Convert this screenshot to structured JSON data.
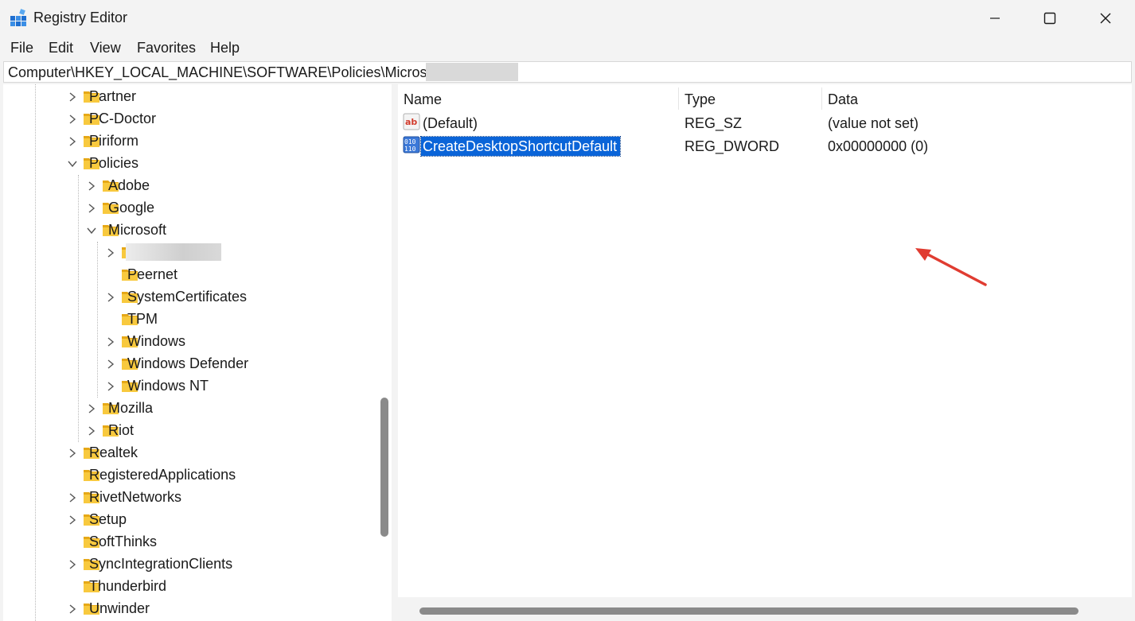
{
  "window": {
    "title": "Registry Editor",
    "controls": {
      "minimize": "minimize",
      "maximize": "maximize",
      "close": "close"
    }
  },
  "menu": [
    "File",
    "Edit",
    "View",
    "Favorites",
    "Help"
  ],
  "address": {
    "path": "Computer\\HKEY_LOCAL_MACHINE\\SOFTWARE\\Policies\\Microsoft\\"
  },
  "tree": {
    "items": [
      {
        "label": "Partner",
        "level": 0,
        "expandable": true,
        "expanded": false
      },
      {
        "label": "PC-Doctor",
        "level": 0,
        "expandable": true,
        "expanded": false
      },
      {
        "label": "Piriform",
        "level": 0,
        "expandable": true,
        "expanded": false
      },
      {
        "label": "Policies",
        "level": 0,
        "expandable": true,
        "expanded": true
      },
      {
        "label": "Adobe",
        "level": 1,
        "expandable": true,
        "expanded": false
      },
      {
        "label": "Google",
        "level": 1,
        "expandable": true,
        "expanded": false
      },
      {
        "label": "Microsoft",
        "level": 1,
        "expandable": true,
        "expanded": true
      },
      {
        "label": "",
        "level": 2,
        "expandable": true,
        "expanded": false,
        "redacted": true,
        "selected": true
      },
      {
        "label": "Peernet",
        "level": 2,
        "expandable": false,
        "expanded": false
      },
      {
        "label": "SystemCertificates",
        "level": 2,
        "expandable": true,
        "expanded": false
      },
      {
        "label": "TPM",
        "level": 2,
        "expandable": false,
        "expanded": false
      },
      {
        "label": "Windows",
        "level": 2,
        "expandable": true,
        "expanded": false
      },
      {
        "label": "Windows Defender",
        "level": 2,
        "expandable": true,
        "expanded": false
      },
      {
        "label": "Windows NT",
        "level": 2,
        "expandable": true,
        "expanded": false
      },
      {
        "label": "Mozilla",
        "level": 1,
        "expandable": true,
        "expanded": false
      },
      {
        "label": "Riot",
        "level": 1,
        "expandable": true,
        "expanded": false
      },
      {
        "label": "Realtek",
        "level": 0,
        "expandable": true,
        "expanded": false
      },
      {
        "label": "RegisteredApplications",
        "level": 0,
        "expandable": false,
        "expanded": false
      },
      {
        "label": "RivetNetworks",
        "level": 0,
        "expandable": true,
        "expanded": false
      },
      {
        "label": "Setup",
        "level": 0,
        "expandable": true,
        "expanded": false
      },
      {
        "label": "SoftThinks",
        "level": 0,
        "expandable": false,
        "expanded": false
      },
      {
        "label": "SyncIntegrationClients",
        "level": 0,
        "expandable": true,
        "expanded": false
      },
      {
        "label": "Thunderbird",
        "level": 0,
        "expandable": false,
        "expanded": false
      },
      {
        "label": "Unwinder",
        "level": 0,
        "expandable": true,
        "expanded": false
      }
    ]
  },
  "list": {
    "columns": [
      "Name",
      "Type",
      "Data"
    ],
    "rows": [
      {
        "icon": "string-value-icon",
        "name": "(Default)",
        "type": "REG_SZ",
        "data": "(value not set)",
        "selected": false
      },
      {
        "icon": "binary-value-icon",
        "name": "CreateDesktopShortcutDefault",
        "type": "REG_DWORD",
        "data": "0x00000000 (0)",
        "selected": true
      }
    ]
  },
  "annotation": {
    "icon": "red-arrow-icon",
    "color": "#e03c31"
  },
  "colors": {
    "selection": "#0a64d8",
    "folder": "#f8c93e",
    "folder_dark": "#e6a817"
  }
}
